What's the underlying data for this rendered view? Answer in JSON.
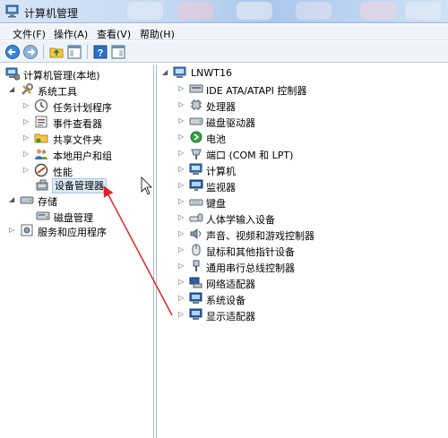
{
  "window": {
    "title": "计算机管理"
  },
  "menu": [
    "文件(F)",
    "操作(A)",
    "查看(V)",
    "帮助(H)"
  ],
  "tree": [
    {
      "label": "计算机管理(本地)",
      "icon": "computer-manage-icon",
      "expander": ""
    },
    {
      "label": "系统工具",
      "icon": "tools-icon",
      "expander": "expanded"
    },
    {
      "label": "任务计划程序",
      "icon": "clock-icon",
      "expander": "collapsed"
    },
    {
      "label": "事件查看器",
      "icon": "event-viewer-icon",
      "expander": "collapsed"
    },
    {
      "label": "共享文件夹",
      "icon": "shared-folder-icon",
      "expander": "collapsed"
    },
    {
      "label": "本地用户和组",
      "icon": "users-icon",
      "expander": "collapsed"
    },
    {
      "label": "性能",
      "icon": "performance-icon",
      "expander": "collapsed"
    },
    {
      "label": "设备管理器",
      "icon": "device-manager-icon",
      "expander": "",
      "selected": true
    },
    {
      "label": "存储",
      "icon": "storage-icon",
      "expander": "expanded"
    },
    {
      "label": "磁盘管理",
      "icon": "disk-management-icon",
      "expander": ""
    },
    {
      "label": "服务和应用程序",
      "icon": "services-icon",
      "expander": "collapsed"
    }
  ],
  "devices": {
    "root": "LNWT16",
    "items": [
      {
        "label": "IDE ATA/ATAPI 控制器",
        "icon": "ide-controller-icon"
      },
      {
        "label": "处理器",
        "icon": "processor-icon"
      },
      {
        "label": "磁盘驱动器",
        "icon": "disk-drive-icon"
      },
      {
        "label": "电池",
        "icon": "battery-icon"
      },
      {
        "label": "端口 (COM 和 LPT)",
        "icon": "port-icon"
      },
      {
        "label": "计算机",
        "icon": "computer-icon"
      },
      {
        "label": "监视器",
        "icon": "monitor-icon"
      },
      {
        "label": "键盘",
        "icon": "keyboard-icon"
      },
      {
        "label": "人体学输入设备",
        "icon": "hid-icon"
      },
      {
        "label": "声音、视频和游戏控制器",
        "icon": "sound-icon"
      },
      {
        "label": "鼠标和其他指针设备",
        "icon": "mouse-icon"
      },
      {
        "label": "通用串行总线控制器",
        "icon": "usb-icon"
      },
      {
        "label": "网络适配器",
        "icon": "network-adapter-icon"
      },
      {
        "label": "系统设备",
        "icon": "system-device-icon"
      },
      {
        "label": "显示适配器",
        "icon": "display-adapter-icon"
      }
    ]
  },
  "colors": {
    "annotation_arrow": "#d9282a",
    "selection": "#dbe9f8"
  }
}
